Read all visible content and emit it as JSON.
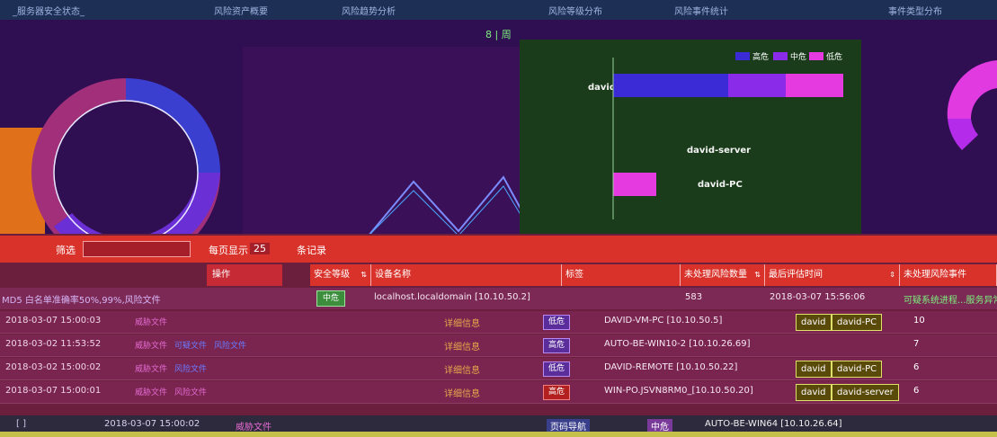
{
  "topbar": {
    "tabs": [
      "_服务器安全状态_",
      "风险资产概要",
      "风险趋势分析",
      "风险等级分布",
      "风险事件统计",
      "事件类型分布"
    ]
  },
  "trend": {
    "pager_label": "8 | 周"
  },
  "bar_chart": {
    "legend": [
      {
        "label": "高危",
        "color": "#3a2bd6"
      },
      {
        "label": "中危",
        "color": "#8a2bea"
      },
      {
        "label": "低危",
        "color": "#e43ae0"
      }
    ],
    "categories": [
      "david",
      "david-server",
      "david-PC"
    ]
  },
  "chart_data": {
    "type": "bar",
    "categories": [
      "david",
      "david-server",
      "david-PC"
    ],
    "series": [
      {
        "name": "高危",
        "values": [
          8,
          0,
          0
        ]
      },
      {
        "name": "中危",
        "values": [
          4,
          0,
          0
        ]
      },
      {
        "name": "低危",
        "values": [
          4,
          0,
          3
        ]
      }
    ]
  },
  "controls": {
    "filter_label": "筛选",
    "show_label": "每页显示",
    "page_size": "25",
    "records_label": "条记录"
  },
  "table": {
    "op_header": "操作",
    "columns": [
      {
        "label": "安全等级"
      },
      {
        "label": "设备名称"
      },
      {
        "label": "标签"
      },
      {
        "label": "未处理风险数量"
      },
      {
        "label": "最后评估时间"
      },
      {
        "label": "未处理风险事件"
      }
    ],
    "first_row": {
      "left_text": "MD5 白名单准确率50%,99%,风险文件",
      "level": "中危",
      "host": "localhost.localdomain [10.10.50.2]",
      "count": "583",
      "time": "2018-03-07 15:56:06",
      "event": "可疑系统进程...服务异常"
    },
    "rows": [
      {
        "time": "2018-03-07 15:00:03",
        "tags": [
          "威胁文件"
        ],
        "detail": "详细信息",
        "level": "低危",
        "level_class": "",
        "host": "DAVID-VM-PC [10.10.50.5]",
        "chips": [
          "david",
          "david-PC"
        ],
        "count": "10"
      },
      {
        "time": "2018-03-02 11:53:52",
        "tags": [
          "威胁文件",
          "可疑文件",
          "风险文件"
        ],
        "detail": "详细信息",
        "level": "高危",
        "level_class": "",
        "host": "AUTO-BE-WIN10-2 [10.10.26.69]",
        "chips": [],
        "count": "7"
      },
      {
        "time": "2018-03-02 15:00:02",
        "tags": [
          "威胁文件",
          "风险文件"
        ],
        "detail": "详细信息",
        "level": "低危",
        "level_class": "",
        "host": "DAVID-REMOTE [10.10.50.22]",
        "chips": [
          "david",
          "david-PC"
        ],
        "count": "6"
      },
      {
        "time": "2018-03-07 15:00:01",
        "tags": [
          "威胁文件",
          "风险文件"
        ],
        "detail": "详细信息",
        "level": "高危",
        "level_class": "high",
        "host": "WIN-PO.JSVN8RM0_[10.10.50.20]",
        "chips": [
          "david",
          "david-server"
        ],
        "count": "6"
      }
    ]
  },
  "bottombar": {
    "left": "[ ]",
    "time": "2018-03-07 15:00:02",
    "tag": "威胁文件",
    "level": "中危",
    "host": "AUTO-BE-WIN64 [10.10.26.64]",
    "page_btn": "页码导航"
  }
}
